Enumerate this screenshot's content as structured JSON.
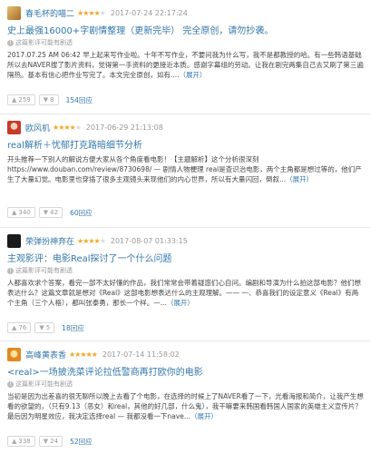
{
  "reviews": [
    {
      "author": "春毛杯的喵二",
      "stars_on": "★★★★",
      "stars_off": "★",
      "date": "2017-07-24 22:17:24",
      "title": "史上最强16000+字剧情整理（更新完毕）",
      "title_suffix": "完全原创，请勿抄袭。",
      "notice": "这篇影评可能有剧透",
      "body": "2017.07.25 AM 06:42 早上起来写作业啦。十年不写作业，不要问我为什么写，我不是都教授的哈。有一些韩语基础所以去NAVER搜了影片资料，觉得第一手资料的更接近本质。感谢字幕组的劳动。让我在剧完两集自己去又刷了第三遍隔热。基本有信心把作业写完了。本文完全原创，如有....",
      "more": "（展开）",
      "up": "259",
      "down": "8",
      "replies": "154回应",
      "avatar_color": "#c8923a"
    },
    {
      "author": "欧风机",
      "stars_on": "★★★★",
      "stars_off": "★",
      "date": "2017-06-29 21:13:08",
      "title": "real解析＋忧郁打克路暗细节分析",
      "title_suffix": "",
      "notice": "",
      "body": "开头推荐一下别人的解说方便大家从各个角度看电影！【主题解析】这个分析很深刻 https://www.douban.com/review/8730698/ — 剧情人物梗理 real是查识治电影，两个主角都是想过等的，他们产生了大量幻觉。电影里也穿插了很多主观镜头来现他们的内心世界，所以有大量闪回，倒叙...",
      "more": "（展开）",
      "up": "340",
      "down": "42",
      "replies": "60回应",
      "avatar_color": "#d24a3a"
    },
    {
      "author": "荣弹扮神弃在",
      "stars_on": "★★★★",
      "stars_off": "★",
      "date": "2017-08-07 01:33:15",
      "title": "主观影评：电影Real探讨了一个什么问题",
      "title_suffix": "",
      "notice": "这篇影评可能有剧透",
      "body": "人都喜欢求个答案，看完一部不太好懂的作品，我们常常会带着疑惑们心自问。编剧和导演为什么拍这部电影？他们想表达什么？这篇文章就是想对《Real》这部电影想表达什么的主观理解。—— 一、恭喜我们的设定意义《Real》有两个主角（三个人格），都叫张泰勇，那长一个样。—...",
      "more": "（展开）",
      "up": "76",
      "down": "5",
      "replies": "18回应",
      "avatar_color": "#1a1a1a"
    },
    {
      "author": "高峰黄表香",
      "stars_on": "★★★★★",
      "stars_off": "",
      "date": "2017-07-14 11:58:02",
      "title": "<real>一场披洗菜评论拉低警商再打欧你的电影",
      "title_suffix": "",
      "notice": "这篇影评可能有剧透",
      "body": "当初是因为出差喜的很无聊所以晚上去看了个电影，在选择的时候上了NAVER看了一下，光看海报和简介，让我产生想看的欲望的，（只有9.13（恶女）和real，其他的好几部，什么鬼），我干嘛要来韩国看韩国人国家的英雄主义宣传片？最后因为明星效应，我决定选择real — 我都没看一下nave...",
      "more": "（展开）",
      "up": "338",
      "down": "24",
      "replies": "52回应",
      "avatar_color": "#e89a30"
    }
  ],
  "icons": {
    "up": "thumbs-up-icon",
    "down": "thumbs-down-icon",
    "warn": "warning-icon"
  }
}
